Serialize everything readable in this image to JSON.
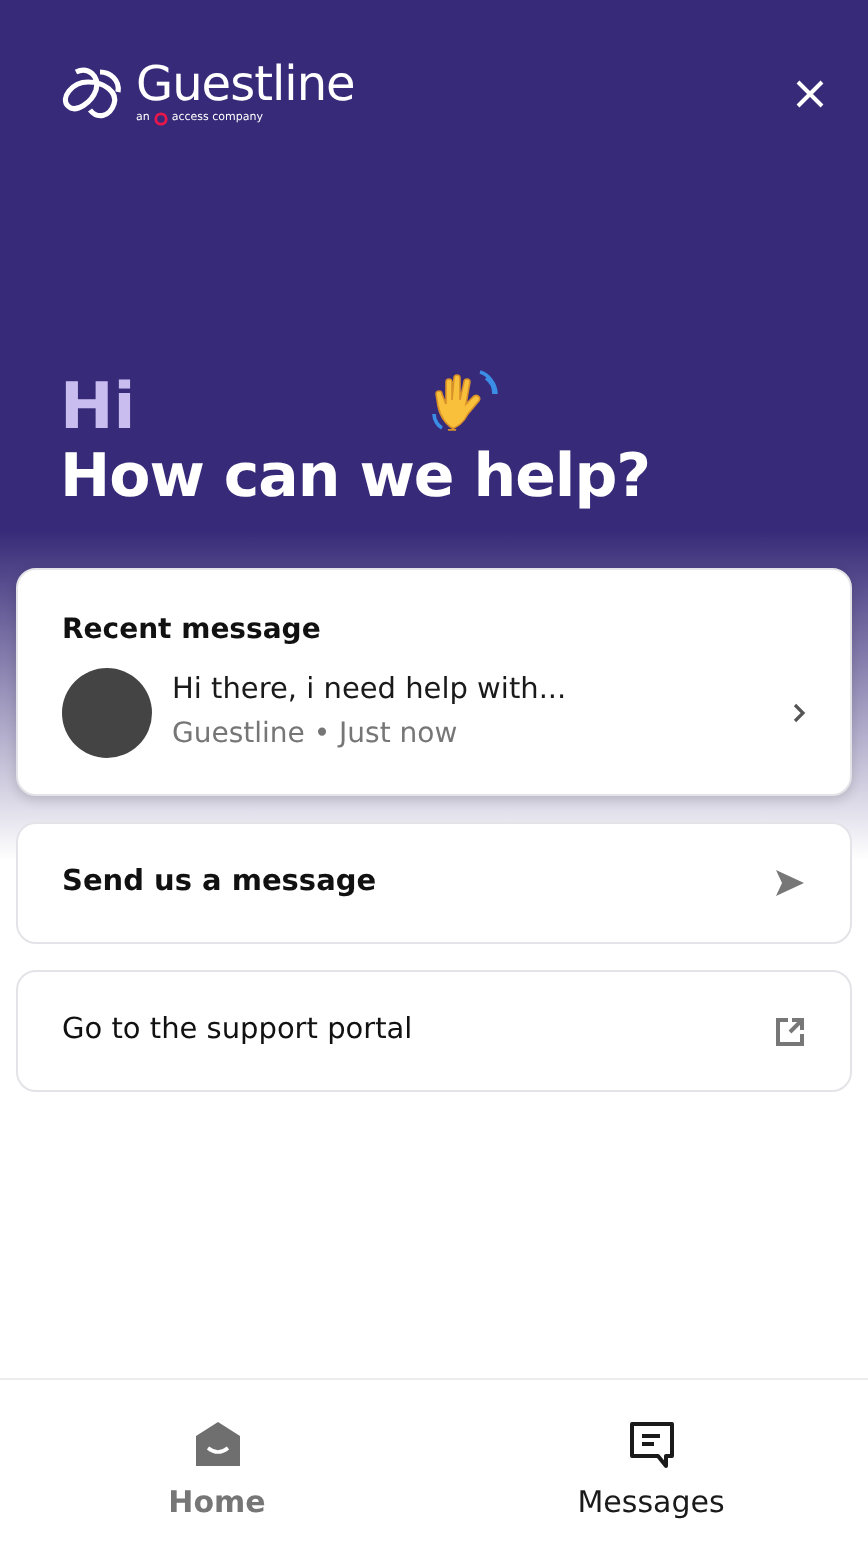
{
  "header": {
    "logo": {
      "name": "Guestline",
      "tagline_prefix": "an",
      "tagline": "access company"
    },
    "greeting": "Hi",
    "headline": "How can we help?"
  },
  "recent": {
    "title": "Recent message",
    "message": "Hi there, i need help with...",
    "meta": "Guestline • Just now"
  },
  "actions": [
    {
      "kind": "send",
      "label": "Send us a message"
    },
    {
      "kind": "external",
      "label": "Go to the support portal"
    }
  ],
  "nav": [
    {
      "kind": "home",
      "label": "Home",
      "selected": true
    },
    {
      "kind": "messages",
      "label": "Messages",
      "selected": false
    }
  ]
}
